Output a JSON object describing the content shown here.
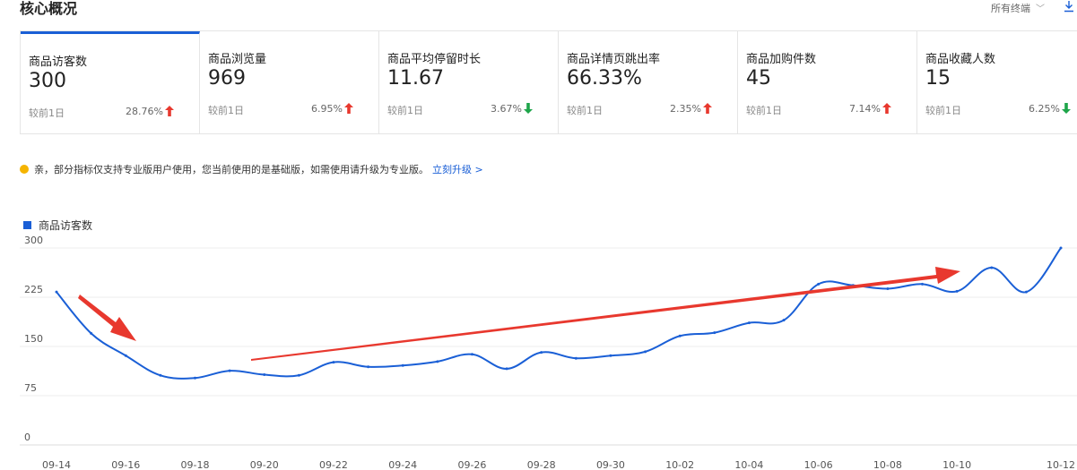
{
  "header": {
    "title": "核心概况",
    "terminal_select": "所有终端"
  },
  "metrics": [
    {
      "label": "商品访客数",
      "value": "300",
      "compare": "较前1日",
      "percent": "28.76%",
      "direction": "up"
    },
    {
      "label": "商品浏览量",
      "value": "969",
      "compare": "较前1日",
      "percent": "6.95%",
      "direction": "up"
    },
    {
      "label": "商品平均停留时长",
      "value": "11.67",
      "compare": "较前1日",
      "percent": "3.67%",
      "direction": "down"
    },
    {
      "label": "商品详情页跳出率",
      "value": "66.33%",
      "compare": "较前1日",
      "percent": "2.35%",
      "direction": "up"
    },
    {
      "label": "商品加购件数",
      "value": "45",
      "compare": "较前1日",
      "percent": "7.14%",
      "direction": "up"
    },
    {
      "label": "商品收藏人数",
      "value": "15",
      "compare": "较前1日",
      "percent": "6.25%",
      "direction": "down"
    }
  ],
  "notice": {
    "text": "亲，部分指标仅支持专业版用户使用，您当前使用的是基础版，如需使用请升级为专业版。",
    "link": "立刻升级 >"
  },
  "colors": {
    "accent": "#1a5fd6",
    "up": "#e8382e",
    "down": "#1ea54a",
    "annotation": "#e8382e"
  },
  "chart_data": {
    "type": "line",
    "title": "",
    "xlabel": "",
    "ylabel": "",
    "ylim": [
      0,
      300
    ],
    "yticks": [
      0,
      75,
      150,
      225,
      300
    ],
    "grid": true,
    "legend_position": "top-left",
    "xtick_labels": [
      "09-14",
      "09-16",
      "09-18",
      "09-20",
      "09-22",
      "09-24",
      "09-26",
      "09-28",
      "09-30",
      "10-02",
      "10-04",
      "10-06",
      "10-08",
      "10-10",
      "10-12"
    ],
    "x": [
      "09-14",
      "09-15",
      "09-16",
      "09-17",
      "09-18",
      "09-19",
      "09-20",
      "09-21",
      "09-22",
      "09-23",
      "09-24",
      "09-25",
      "09-26",
      "09-27",
      "09-28",
      "09-29",
      "09-30",
      "10-01",
      "10-02",
      "10-03",
      "10-04",
      "10-05",
      "10-06",
      "10-07",
      "10-08",
      "10-09",
      "10-10",
      "10-11",
      "10-12",
      "10-13"
    ],
    "series": [
      {
        "name": "商品访客数",
        "values": [
          233,
          170,
          136,
          106,
          102,
          113,
          107,
          106,
          126,
          119,
          121,
          127,
          138,
          116,
          141,
          132,
          136,
          142,
          166,
          171,
          186,
          190,
          245,
          243,
          238,
          245,
          234,
          270,
          233,
          300
        ]
      }
    ]
  }
}
